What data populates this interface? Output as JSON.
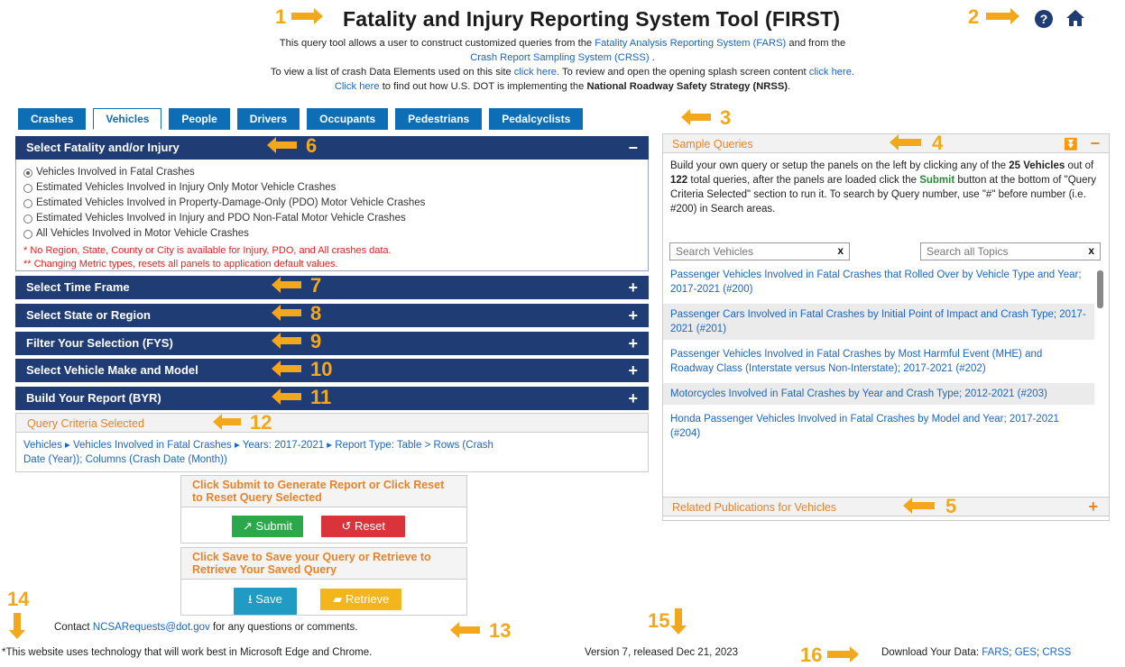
{
  "header": {
    "title": "Fatality and Injury Reporting System Tool (FIRST)",
    "intro1_pre": "This query tool allows a user to construct customized queries from the ",
    "intro1_link": "Fatality Analysis Reporting System (FARS)",
    "intro1_post": " and from the",
    "intro2_link": "Crash Report Sampling System (CRSS)",
    "intro2_post": " .",
    "intro3_pre": "To view a list of crash Data Elements used on this site ",
    "intro3_link1": "click here.",
    "intro3_mid": " To review and open the opening splash screen content ",
    "intro3_link2": "click here.",
    "intro4_link": "Click here",
    "intro4_mid": " to find out how U.S. DOT is implementing the ",
    "intro4_bold": "National Roadway Safety Strategy (NRSS)",
    "intro4_post": "."
  },
  "icons": {
    "help": "help-circle-icon",
    "home": "home-icon"
  },
  "tabs": [
    "Crashes",
    "Vehicles",
    "People",
    "Drivers",
    "Occupants",
    "Pedestrians",
    "Pedalcyclists"
  ],
  "active_tab": "Vehicles",
  "fatality_panel": {
    "title": "Select Fatality and/or Injury",
    "toggle": "−",
    "options": [
      "Vehicles Involved in Fatal Crashes",
      "Estimated Vehicles Involved in Injury Only Motor Vehicle Crashes",
      "Estimated Vehicles Involved in Property-Damage-Only (PDO) Motor Vehicle Crashes",
      "Estimated Vehicles Involved in Injury and PDO Non-Fatal Motor Vehicle Crashes",
      "All Vehicles Involved in Motor Vehicle Crashes"
    ],
    "note1": "* No Region, State, County or City is available for Injury, PDO, and All crashes data.",
    "note2": "** Changing Metric types, resets all panels to application default values."
  },
  "panels": [
    {
      "title": "Select Time Frame",
      "toggle": "+"
    },
    {
      "title": "Select State or Region",
      "toggle": "+"
    },
    {
      "title": "Filter Your Selection (FYS)",
      "toggle": "+"
    },
    {
      "title": "Select Vehicle Make and Model",
      "toggle": "+"
    },
    {
      "title": "Build Your Report (BYR)",
      "toggle": "+"
    }
  ],
  "query_criteria": {
    "title": "Query Criteria Selected",
    "line1": "Vehicles ▸ Vehicles Involved in Fatal Crashes ▸ Years: 2017-2021 ▸ Report Type: Table > Rows (Crash",
    "line2": "Date (Year)); Columns (Crash Date (Month))"
  },
  "actions": {
    "submit_hdr": "Click Submit to Generate Report or Click Reset to Reset Query Selected",
    "submit": "Submit",
    "reset": "Reset",
    "save_hdr": "Click Save to Save your Query or Retrieve to Retrieve Your Saved Query",
    "save": "Save",
    "retrieve": "Retrieve"
  },
  "sample_queries": {
    "title": "Sample Queries",
    "desc_1": "Build your own query or setup the panels on the left by clicking any of the ",
    "desc_bold1": "25 Vehicles",
    "desc_2": " out of ",
    "desc_bold2": "122",
    "desc_3": " total queries, after the panels are loaded click the ",
    "desc_green": "Submit",
    "desc_4": " button at the bottom of \"Query Criteria Selected\" section to run it. To search by Query number, use \"#\" before number (i.e. #200) in Search areas.",
    "search_vehicles": "Search Vehicles",
    "search_all": "Search all Topics",
    "items": [
      "Passenger Vehicles Involved in Fatal Crashes that Rolled Over by Vehicle Type and Year; 2017-2021 (#200)",
      "Passenger Cars Involved in Fatal Crashes by Initial Point of Impact and Crash Type; 2017-2021 (#201)",
      "Passenger Vehicles Involved in Fatal Crashes by Most Harmful Event (MHE) and Roadway Class (Interstate versus Non-Interstate); 2017-2021 (#202)",
      "Motorcycles Involved in Fatal Crashes by Year and Crash Type; 2012-2021 (#203)",
      "Honda Passenger Vehicles Involved in Fatal Crashes by Model and Year; 2017-2021 (#204)"
    ]
  },
  "related": {
    "title": "Related Publications for Vehicles",
    "toggle": "+"
  },
  "footer": {
    "contact_pre": "Contact ",
    "contact_link": "NCSARequests@dot.gov",
    "contact_post": " for any questions or comments.",
    "browser_note": "*This website uses technology that will work best in Microsoft Edge and Chrome.",
    "version": "Version 7, released Dec 21, 2023",
    "download_label": "Download Your Data: ",
    "download_links": [
      "FARS",
      "GES",
      "CRSS"
    ]
  },
  "callouts": [
    "1",
    "2",
    "3",
    "4",
    "5",
    "6",
    "7",
    "8",
    "9",
    "10",
    "11",
    "12",
    "13",
    "14",
    "15",
    "16"
  ],
  "colors": {
    "panel_header": "#1f3c75",
    "tab": "#0d6db5",
    "callout": "#f3a81c",
    "submit": "#2aa84a",
    "reset": "#d9343c",
    "save": "#1f9bc4",
    "retrieve": "#f3b51c"
  }
}
